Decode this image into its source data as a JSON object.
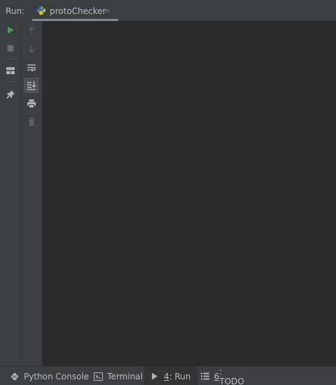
{
  "header": {
    "run_label": "Run:",
    "tab": {
      "title": "protoChecker",
      "close_glyph": "×",
      "icon": "python-icon"
    }
  },
  "left_toolbar": {
    "buttons": [
      {
        "name": "rerun-button",
        "icon": "play-icon",
        "color": "#499c54"
      },
      {
        "name": "stop-button",
        "icon": "stop-icon",
        "color": "#6e6e6e"
      },
      {
        "name": "layout-button",
        "icon": "layout-icon",
        "color": "#afb1b3"
      },
      {
        "name": "pin-tab-button",
        "icon": "pin-icon",
        "color": "#afb1b3"
      }
    ]
  },
  "second_toolbar": {
    "buttons": [
      {
        "name": "up-stack-button",
        "icon": "arrow-up-icon",
        "color": "#5e6060"
      },
      {
        "name": "down-stack-button",
        "icon": "arrow-down-icon",
        "color": "#5e6060"
      },
      {
        "name": "soft-wrap-button",
        "icon": "soft-wrap-icon",
        "color": "#afb1b3"
      },
      {
        "name": "scroll-to-end-button",
        "icon": "scroll-to-end-icon",
        "color": "#afb1b3",
        "active": true
      },
      {
        "name": "print-button",
        "icon": "print-icon",
        "color": "#afb1b3"
      },
      {
        "name": "clear-all-button",
        "icon": "trash-icon",
        "color": "#5e6060"
      }
    ]
  },
  "console": {
    "text": ""
  },
  "bottom_tabs": [
    {
      "name": "python-console-tab",
      "icon": "python-icon",
      "label": "Python Console",
      "mnemonic": "",
      "active": false
    },
    {
      "name": "terminal-tab",
      "icon": "terminal-icon",
      "label": "Terminal",
      "mnemonic": "",
      "active": false
    },
    {
      "name": "run-tab",
      "icon": "play-icon",
      "label": ": Run",
      "mnemonic": "4",
      "active": true
    },
    {
      "name": "todo-tab",
      "icon": "list-icon",
      "label": ": TODO",
      "mnemonic": "6",
      "active": false
    }
  ],
  "colors": {
    "panel_bg": "#3c3f41",
    "console_bg": "#2b2b2b",
    "tab_underline": "#7f8c98",
    "run_green": "#499c54"
  }
}
